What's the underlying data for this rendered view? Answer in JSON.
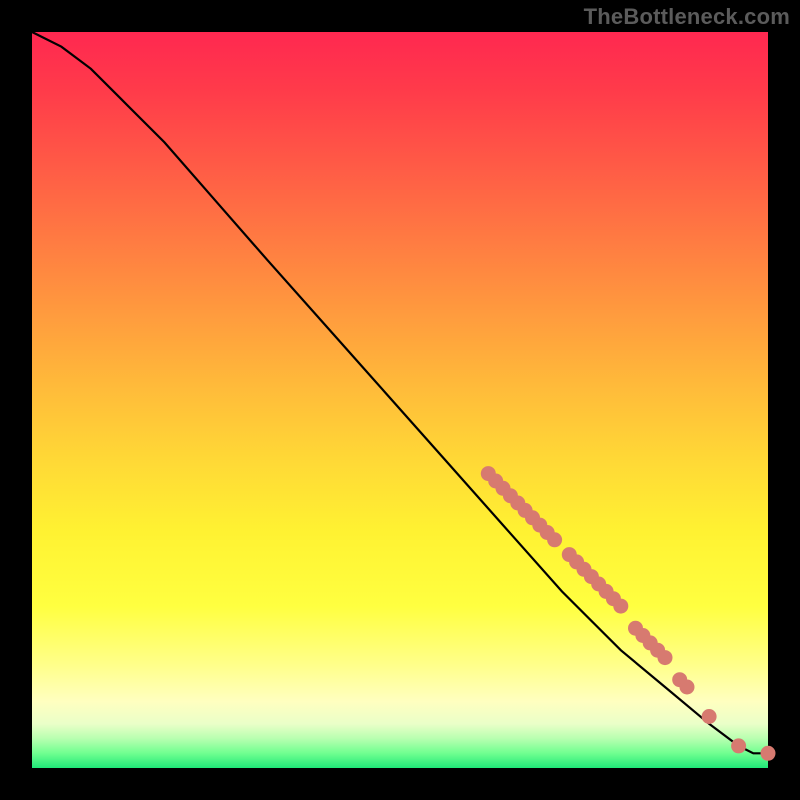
{
  "watermark": "TheBottleneck.com",
  "chart_data": {
    "type": "line",
    "title": "",
    "xlabel": "",
    "ylabel": "",
    "xlim": [
      0,
      100
    ],
    "ylim": [
      0,
      100
    ],
    "series": [
      {
        "name": "curve",
        "x": [
          0,
          4,
          8,
          12,
          18,
          25,
          32,
          40,
          48,
          56,
          64,
          72,
          80,
          86,
          92,
          96,
          98,
          100
        ],
        "y": [
          100,
          98,
          95,
          91,
          85,
          77,
          69,
          60,
          51,
          42,
          33,
          24,
          16,
          11,
          6,
          3,
          2,
          2
        ]
      }
    ],
    "scatter": [
      {
        "name": "dots",
        "color": "#d77a70",
        "points": [
          {
            "x": 62,
            "y": 40
          },
          {
            "x": 63,
            "y": 39
          },
          {
            "x": 64,
            "y": 38
          },
          {
            "x": 65,
            "y": 37
          },
          {
            "x": 66,
            "y": 36
          },
          {
            "x": 67,
            "y": 35
          },
          {
            "x": 68,
            "y": 34
          },
          {
            "x": 69,
            "y": 33
          },
          {
            "x": 70,
            "y": 32
          },
          {
            "x": 71,
            "y": 31
          },
          {
            "x": 73,
            "y": 29
          },
          {
            "x": 74,
            "y": 28
          },
          {
            "x": 75,
            "y": 27
          },
          {
            "x": 76,
            "y": 26
          },
          {
            "x": 77,
            "y": 25
          },
          {
            "x": 78,
            "y": 24
          },
          {
            "x": 79,
            "y": 23
          },
          {
            "x": 80,
            "y": 22
          },
          {
            "x": 82,
            "y": 19
          },
          {
            "x": 83,
            "y": 18
          },
          {
            "x": 84,
            "y": 17
          },
          {
            "x": 85,
            "y": 16
          },
          {
            "x": 86,
            "y": 15
          },
          {
            "x": 88,
            "y": 12
          },
          {
            "x": 89,
            "y": 11
          },
          {
            "x": 92,
            "y": 7
          },
          {
            "x": 96,
            "y": 3
          },
          {
            "x": 100,
            "y": 2
          }
        ]
      }
    ]
  }
}
